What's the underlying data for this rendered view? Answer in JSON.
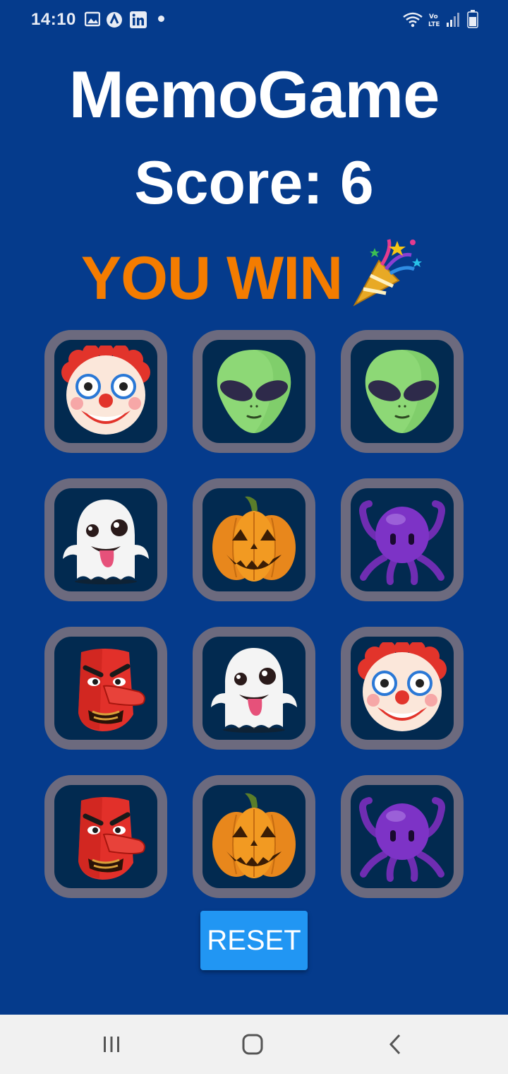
{
  "status_bar": {
    "time": "14:10",
    "left_icons": [
      "image-icon",
      "app-icon",
      "linkedin-icon",
      "dot"
    ],
    "right_icons": [
      "wifi-icon",
      "volte-icon",
      "signal-icon",
      "battery-icon"
    ]
  },
  "app": {
    "title": "MemoGame",
    "score_label": "Score:",
    "score_value": "6",
    "win_message": "YOU WIN",
    "win_icon": "party-popper-icon",
    "reset_label": "RESET"
  },
  "board": {
    "rows": 4,
    "cols": 3,
    "cards": [
      {
        "emoji": "clown-face"
      },
      {
        "emoji": "alien"
      },
      {
        "emoji": "alien"
      },
      {
        "emoji": "ghost"
      },
      {
        "emoji": "jack-o-lantern"
      },
      {
        "emoji": "octopus"
      },
      {
        "emoji": "tengu-goblin"
      },
      {
        "emoji": "ghost"
      },
      {
        "emoji": "clown-face"
      },
      {
        "emoji": "tengu-goblin"
      },
      {
        "emoji": "jack-o-lantern"
      },
      {
        "emoji": "octopus"
      }
    ]
  },
  "colors": {
    "background": "#053b8c",
    "card_border": "#6c6a7e",
    "card_fill": "#022a50",
    "win_text": "#f47c00",
    "reset_button": "#2196f3"
  },
  "nav_bar": {
    "buttons": [
      "recent-apps-icon",
      "home-icon",
      "back-icon"
    ]
  }
}
